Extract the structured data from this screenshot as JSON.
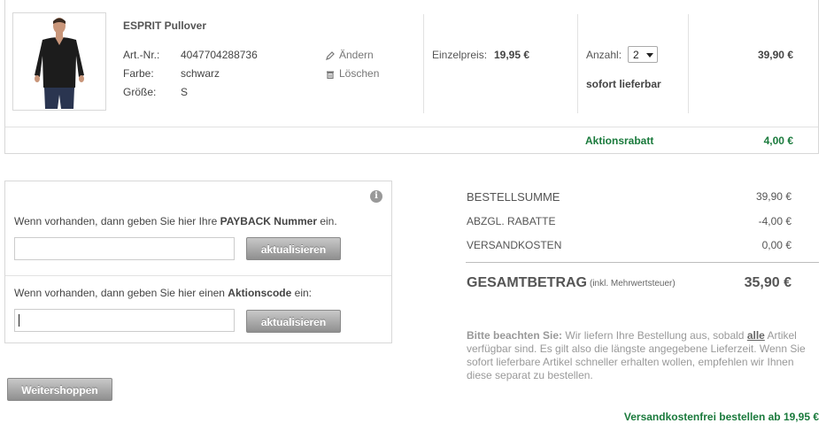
{
  "product": {
    "name": "ESPRIT Pullover",
    "attributes": [
      {
        "label": "Art.-Nr.:",
        "value": "4047704288736"
      },
      {
        "label": "Farbe:",
        "value": "schwarz"
      },
      {
        "label": "Größe:",
        "value": "S"
      }
    ],
    "edit_label": "Ändern",
    "delete_label": "Löschen",
    "unit_price_label": "Einzelpreis:",
    "unit_price": "19,95 €",
    "quantity_label": "Anzahl:",
    "quantity": "2",
    "availability": "sofort lieferbar",
    "line_total": "39,90 €",
    "discount_label": "Aktionsrabatt",
    "discount_value": "4,00 €"
  },
  "codes": {
    "payback_prefix": "Wenn vorhanden, dann geben Sie hier Ihre ",
    "payback_bold": "PAYBACK Nummer",
    "payback_suffix": " ein.",
    "payback_value": "",
    "payback_button": "aktualisieren",
    "promo_prefix": "Wenn vorhanden, dann geben Sie hier einen ",
    "promo_bold": "Aktionscode",
    "promo_suffix": " ein:",
    "promo_value": "",
    "promo_button": "aktualisieren",
    "info_icon": "i"
  },
  "summary": {
    "rows": [
      {
        "label": "BESTELLSUMME",
        "value": "39,90 €"
      },
      {
        "label": "ABZGL. RABATTE",
        "value": "-4,00 €"
      },
      {
        "label": "VERSANDKOSTEN",
        "value": "0,00 €"
      }
    ],
    "total_label": "GESAMTBETRAG",
    "total_note": "(inkl. Mehrwertsteuer)",
    "total_value": "35,90 €",
    "note_bold": "Bitte beachten Sie:",
    "note_part1": " Wir liefern Ihre Bestellung aus, sobald ",
    "note_underline": "alle",
    "note_part2": " Artikel verfügbar sind. Es gilt also die längste angegebene Lieferzeit. Wenn Sie sofort lieferbare Artikel schneller erhalten wollen, empfehlen wir Ihnen diese separat zu bestellen."
  },
  "continue_label": "Weitershoppen",
  "free_shipping": "Versandkostenfrei bestellen ab 19,95 €",
  "colors": {
    "accent_green": "#1a7a3c",
    "text": "#555555",
    "border": "#d8d8d8"
  }
}
